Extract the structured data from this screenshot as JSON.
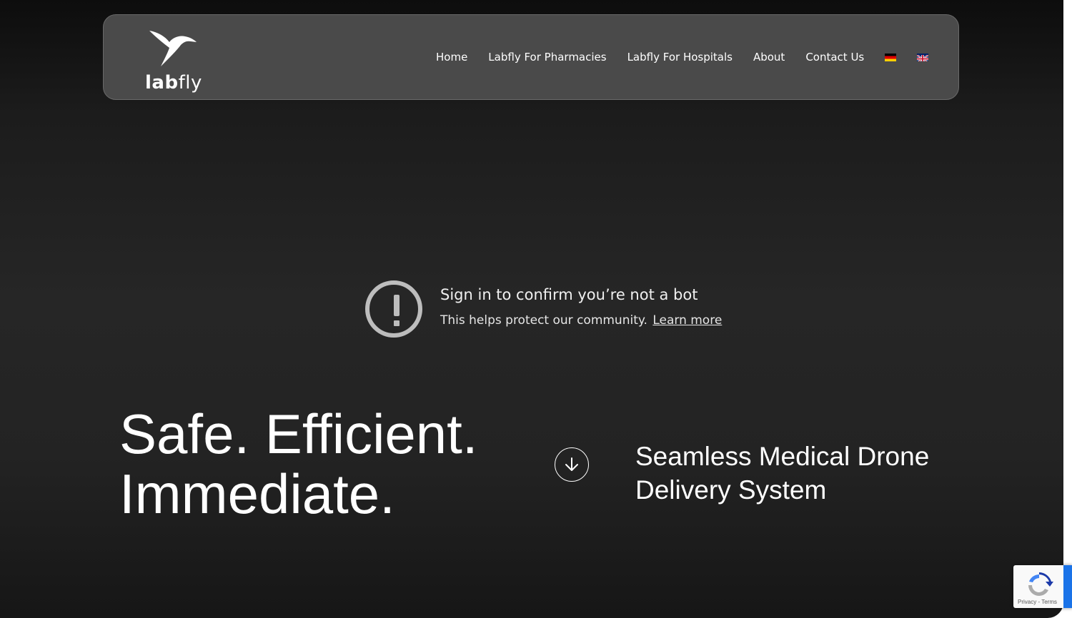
{
  "header": {
    "logo": {
      "brand_bold": "lab",
      "brand_light": "fly"
    },
    "nav": [
      {
        "label": "Home"
      },
      {
        "label": "Labfly For Pharmacies"
      },
      {
        "label": "Labfly For Hospitals"
      },
      {
        "label": "About"
      },
      {
        "label": "Contact Us"
      }
    ],
    "languages": [
      {
        "icon": "german-flag-icon"
      },
      {
        "icon": "uk-flag-icon"
      }
    ]
  },
  "bot_notice": {
    "icon": "warning-icon",
    "title": "Sign in to confirm you’re not a bot",
    "subtitle": "This helps protect our community.",
    "link": "Learn more"
  },
  "hero": {
    "title_line1": "Safe. Efficient.",
    "title_line2": "Immediate.",
    "scroll_icon": "arrow-down-icon",
    "subtitle_line1": "Seamless Medical Drone",
    "subtitle_line2": "Delivery System"
  },
  "recaptcha": {
    "privacy": "Privacy",
    "separator": " - ",
    "terms": "Terms"
  },
  "colors": {
    "background": "#232323",
    "header_bg": "#4a4a4a",
    "text": "#ffffff",
    "recaptcha_accent": "#1a73e8"
  }
}
